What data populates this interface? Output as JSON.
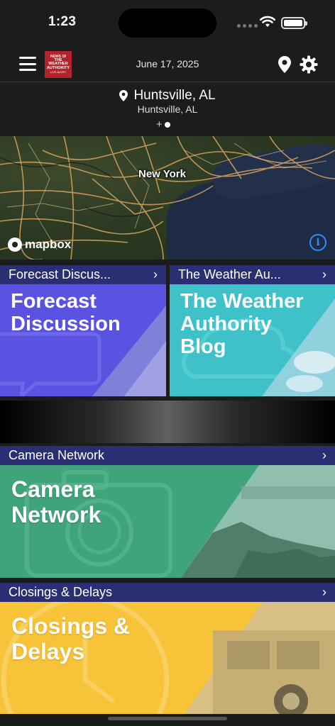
{
  "status_bar": {
    "time": "1:23"
  },
  "header": {
    "logo": {
      "line1": "NEWS 19",
      "line2": "THE WEATHER AUTHORITY",
      "line3": "LIVE ALERT"
    },
    "date": "June 17, 2025"
  },
  "location": {
    "name": "Huntsville, AL",
    "subtitle": "Huntsville, AL",
    "add_symbol": "+"
  },
  "map": {
    "city_label": "New York",
    "attribution": "mapbox",
    "info_symbol": "i"
  },
  "tiles": {
    "forecast": {
      "header": "Forecast Discus...",
      "title_line1": "Forecast",
      "title_line2": "Discussion"
    },
    "weather_authority": {
      "header": "The Weather Au...",
      "title_line1": "The Weather",
      "title_line2": "Authority",
      "title_line3": "Blog"
    },
    "camera": {
      "header": "Camera Network",
      "title_line1": "Camera",
      "title_line2": "Network"
    },
    "closings": {
      "header": "Closings & Delays",
      "title_line1": "Closings &",
      "title_line2": "Delays"
    }
  },
  "chevron": "›",
  "icons": {
    "menu": "menu-icon",
    "location": "map-pin-icon",
    "settings": "gear-icon",
    "wifi": "wifi-icon",
    "battery": "battery-icon",
    "info": "info-icon"
  },
  "colors": {
    "background": "#1c1c1c",
    "tile_header": "#2a2e72",
    "forecast_tile": "#5a53e2",
    "weather_authority_tile": "#3ec1c9",
    "camera_tile": "#3fa47c",
    "closings_tile": "#f7c339",
    "logo_red": "#b3232b",
    "info_blue": "#2f8fff"
  }
}
